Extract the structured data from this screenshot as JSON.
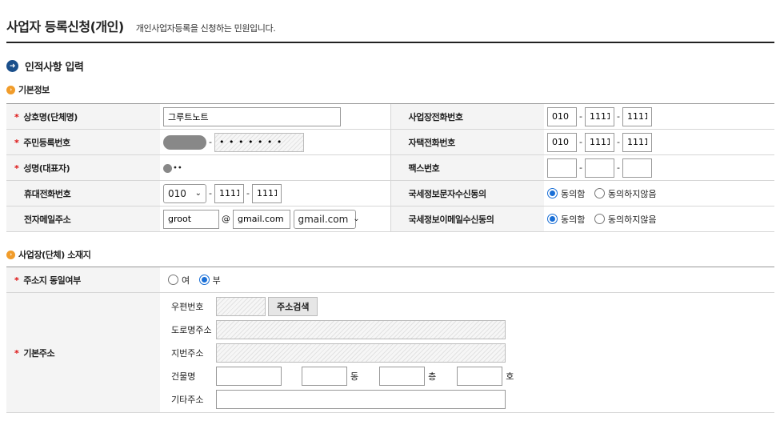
{
  "header": {
    "title": "사업자 등록신청(개인)",
    "description": "개인사업자등록을 신청하는 민원입니다."
  },
  "section": {
    "title": "인적사항 입력"
  },
  "basic": {
    "title": "기본정보",
    "business_name_label": "상호명(단체명)",
    "business_name_value": "그루트노트",
    "resident_no_label": "주민등록번호",
    "resident_no_back": "• • • • • • •",
    "name_label": "성명(대표자)",
    "name_masked": "••",
    "mobile_label": "휴대전화번호",
    "mobile_carrier": "010",
    "mobile_mid": "1111",
    "mobile_last": "1111",
    "email_label": "전자메일주소",
    "email_id": "groot",
    "email_at": "@",
    "email_domain": "gmail.com",
    "email_domain_select": "gmail.com",
    "biz_phone_label": "사업장전화번호",
    "biz_phone": [
      "010",
      "1111",
      "1111"
    ],
    "home_phone_label": "자택전화번호",
    "home_phone": [
      "010",
      "1111",
      "1111"
    ],
    "fax_label": "팩스번호",
    "fax": [
      "",
      "",
      ""
    ],
    "sms_consent_label": "국세정보문자수신동의",
    "email_consent_label": "국세정보이메일수신동의",
    "agree": "동의함",
    "disagree": "동의하지않음",
    "sms_consent_selected": "동의함",
    "email_consent_selected": "동의함",
    "dash": "-"
  },
  "location": {
    "title": "사업장(단체) 소재지",
    "same_address_label": "주소지 동일여부",
    "yes": "여",
    "no": "부",
    "same_address_selected": "부",
    "base_address_label": "기본주소",
    "postal_code_label": "우편번호",
    "search_button": "주소검색",
    "road_address_label": "도로명주소",
    "lot_address_label": "지번주소",
    "building_label": "건물명",
    "dong_unit": "동",
    "floor_unit": "층",
    "ho_unit": "호",
    "other_address_label": "기타주소"
  },
  "colors": {
    "accent": "#1a4f8b",
    "bullet": "#f19c2a",
    "required": "#dd1111",
    "radio": "#1a6fd6"
  }
}
